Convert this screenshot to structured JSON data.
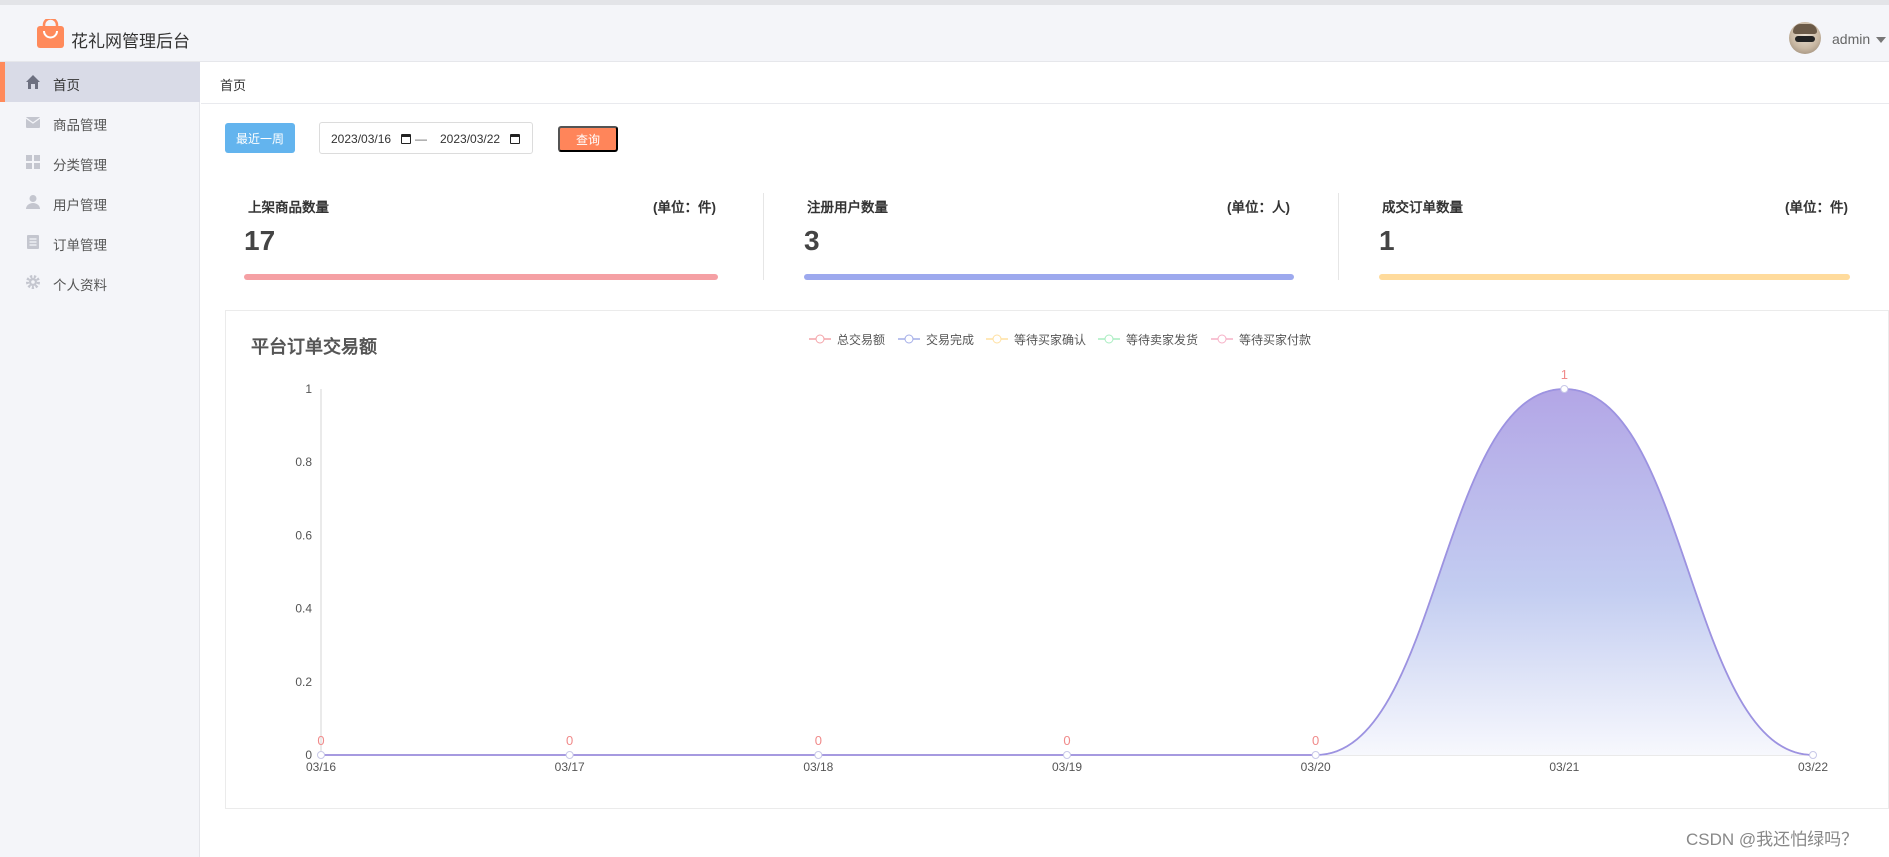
{
  "app": {
    "title": "花礼网管理后台",
    "user_name": "admin",
    "brand_color": "#ff8a5b"
  },
  "sidebar": {
    "items": [
      {
        "label": "首页",
        "icon": "home-icon",
        "active": true
      },
      {
        "label": "商品管理",
        "icon": "mail-icon",
        "active": false
      },
      {
        "label": "分类管理",
        "icon": "grid-icon",
        "active": false
      },
      {
        "label": "用户管理",
        "icon": "user-icon",
        "active": false
      },
      {
        "label": "订单管理",
        "icon": "document-icon",
        "active": false
      },
      {
        "label": "个人资料",
        "icon": "gear-icon",
        "active": false
      }
    ]
  },
  "breadcrumb": "首页",
  "filters": {
    "recent_week_label": "最近一周",
    "start_date": "2023/03/16",
    "end_date": "2023/03/22",
    "separator": "—",
    "query_label": "查询"
  },
  "stats": [
    {
      "title": "上架商品数量",
      "unit": "(单位：件)",
      "value": "17",
      "color": "#f5a0a4"
    },
    {
      "title": "注册用户数量",
      "unit": "(单位：人)",
      "value": "3",
      "color": "#9da9ee"
    },
    {
      "title": "成交订单数量",
      "unit": "(单位：件)",
      "value": "1",
      "color": "#ffdb9c"
    }
  ],
  "chart_data": {
    "type": "area",
    "title": "平台订单交易额",
    "legend_placement": "top-center",
    "categories": [
      "03/16",
      "03/17",
      "03/18",
      "03/19",
      "03/20",
      "03/21",
      "03/22"
    ],
    "ylim": [
      0,
      1
    ],
    "yticks": [
      "0",
      "0.2",
      "0.4",
      "0.6",
      "0.8",
      "1"
    ],
    "series": [
      {
        "name": "总交易额",
        "color": "#f4a3a8",
        "values": [
          0,
          0,
          0,
          0,
          0,
          1,
          0
        ]
      },
      {
        "name": "交易完成",
        "color": "#a3ade8",
        "values": [
          0,
          0,
          0,
          0,
          0,
          1,
          0
        ]
      },
      {
        "name": "等待买家确认",
        "color": "#ffe0a0",
        "values": []
      },
      {
        "name": "等待卖家发货",
        "color": "#a8edc0",
        "values": []
      },
      {
        "name": "等待买家付款",
        "color": "#f6b0c6",
        "values": []
      }
    ],
    "data_labels": [
      "0",
      "0",
      "0",
      "0",
      "0",
      "1"
    ]
  },
  "watermark": "CSDN @我还怕绿吗？"
}
